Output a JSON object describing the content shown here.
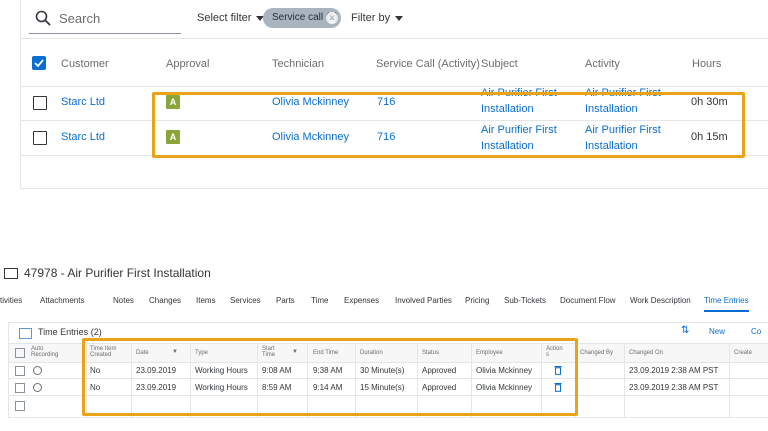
{
  "toolbar": {
    "search_placeholder": "Search",
    "select_filter_label": "Select filter",
    "chip_label": "Service call (1)",
    "filter_by_label": "Filter by"
  },
  "table": {
    "columns": [
      "Customer",
      "Approval",
      "Technician",
      "Service Call (Activity)",
      "Subject",
      "Activity",
      "Hours"
    ],
    "rows": [
      {
        "customer": "Starc Ltd",
        "approval": "A",
        "technician": "Olivia Mckinney",
        "service_call": "716",
        "subject_l1": "Air Purifier First",
        "subject_l2": "Installation",
        "activity_l1": "Air Purifier First",
        "activity_l2": "Installation",
        "hours": "0h 30m"
      },
      {
        "customer": "Starc Ltd",
        "approval": "A",
        "technician": "Olivia Mckinney",
        "service_call": "716",
        "subject_l1": "Air Purifier First",
        "subject_l2": "Installation",
        "activity_l1": "Air Purifier First",
        "activity_l2": "Installation",
        "hours": "0h 15m"
      }
    ]
  },
  "object": {
    "title": "47978 - Air Purifier First Installation",
    "tabs": [
      "tivities",
      "Attachments",
      "Notes",
      "Changes",
      "Items",
      "Services",
      "Parts",
      "Time",
      "Expenses",
      "Involved Parties",
      "Pricing",
      "Sub-Tickets",
      "Document Flow",
      "Work Description",
      "Time Entries"
    ]
  },
  "time_entries": {
    "title": "Time Entries",
    "count": "(2)",
    "sort_icon": "sort-icon",
    "new_label": "New",
    "copy_label": "Co",
    "columns": {
      "auto_recording": "Auto Recording",
      "time_item_created": "Time Item Created",
      "date": "Date",
      "type": "Type",
      "start_time": "Start Time",
      "end_time": "End Time",
      "duration": "Duration",
      "status": "Status",
      "employee": "Employee",
      "actions": "Action s",
      "changed_by": "Changed By",
      "changed_on": "Changed On",
      "created": "Create"
    },
    "rows": [
      {
        "time_item_created": "No",
        "date": "23.09.2019",
        "type": "Working Hours",
        "start": "9:08 AM",
        "end": "9:38 AM",
        "duration": "30 Minute(s)",
        "status": "Approved",
        "employee": "Olivia Mckinney",
        "changed_on": "23.09.2019 2:38 AM PST"
      },
      {
        "time_item_created": "No",
        "date": "23.09.2019",
        "type": "Working Hours",
        "start": "8:59 AM",
        "end": "9:14 AM",
        "duration": "15 Minute(s)",
        "status": "Approved",
        "employee": "Olivia Mckinney",
        "changed_on": "23.09.2019 2:38 AM PST"
      }
    ]
  },
  "colors": {
    "accent": "#0a6ed1",
    "highlight": "#e8a317",
    "approval_badge": "#8aa63a"
  }
}
